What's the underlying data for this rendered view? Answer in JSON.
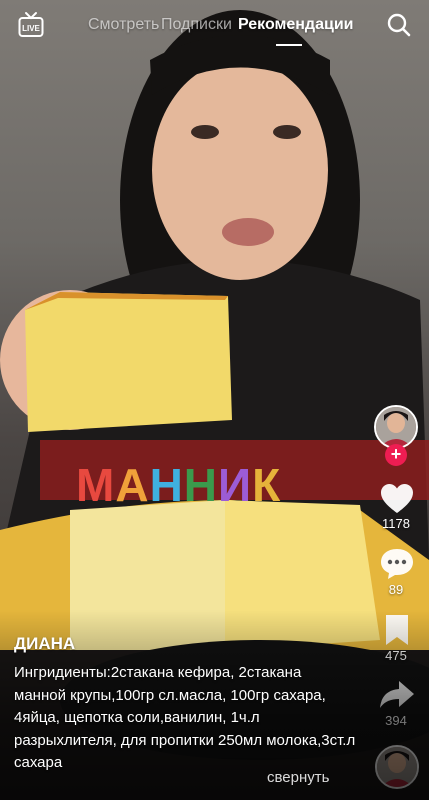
{
  "topbar": {
    "live_label": "LIVE",
    "tabs": [
      {
        "label": "Смотреть",
        "active": false
      },
      {
        "label": "Подписки",
        "active": false
      },
      {
        "label": "Рекомендации",
        "active": true
      }
    ],
    "search_icon": "search-icon"
  },
  "overlay": {
    "title": "МАННИК",
    "letter_colors": [
      "#e8493f",
      "#f0a13a",
      "#3fb0e0",
      "#3a9a4c",
      "#9c5cd6",
      "#e6b33a"
    ]
  },
  "rail": {
    "likes": "1178",
    "comments": "89",
    "saves": "475",
    "shares": "394",
    "follow_symbol": "+",
    "accent": "#ee1d52"
  },
  "post": {
    "username": "ДИАНА",
    "description": "Ингридиенты:2стакана кефира, 2стакана манной крупы,100гр сл.масла, 100гр сахара, 4яйца, щепотка соли,ванилин, 1ч.л разрыхлителя, для пропитки 250мл молока,3ст.л сахара",
    "collapse_label": "свернуть"
  }
}
